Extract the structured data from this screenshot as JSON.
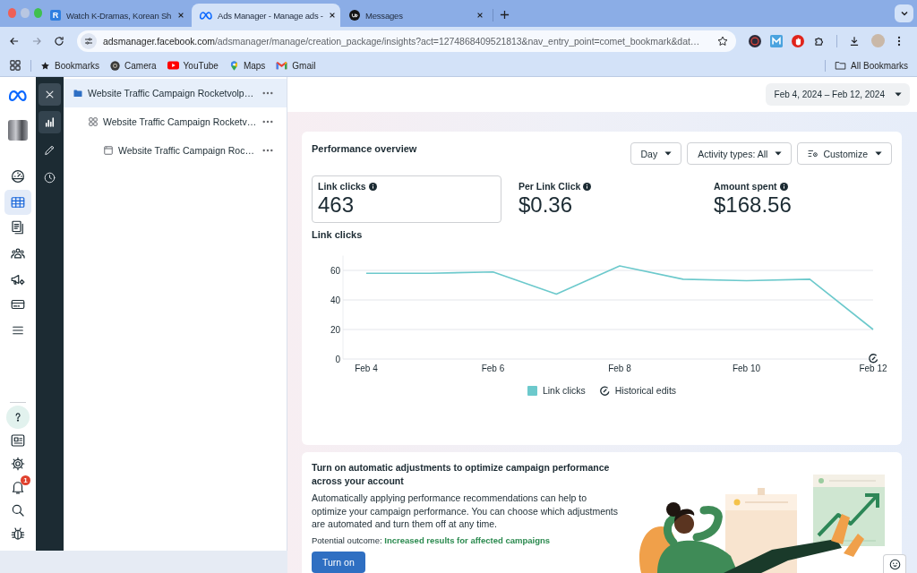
{
  "browser": {
    "tabs": [
      {
        "title": "Watch K-Dramas, Korean Sh",
        "kind": "letter",
        "favicon_text": "R",
        "selected": false
      },
      {
        "title": "Ads Manager - Manage ads -",
        "kind": "meta",
        "selected": true
      },
      {
        "title": "Messages",
        "kind": "round",
        "selected": false
      }
    ],
    "address": {
      "host": "adsmanager.facebook.com",
      "path": "/adsmanager/manage/creation_package/insights?act=1274868409521813&nav_entry_point=comet_bookmark&dat…"
    },
    "bookmarks": [
      {
        "label": "Bookmarks",
        "kind": "star"
      },
      {
        "label": "Camera",
        "kind": "camera"
      },
      {
        "label": "YouTube",
        "kind": "video"
      },
      {
        "label": "Maps",
        "kind": "pin"
      },
      {
        "label": "Gmail",
        "kind": "mail"
      }
    ],
    "all_bookmarks": "All Bookmarks"
  },
  "nav_rail": {
    "top": [
      {
        "kind": "gauge",
        "selected": false
      },
      {
        "kind": "table",
        "selected": true
      },
      {
        "kind": "pages",
        "selected": false
      },
      {
        "kind": "people",
        "selected": false
      },
      {
        "kind": "megaphone",
        "selected": false
      },
      {
        "kind": "card",
        "selected": false
      },
      {
        "kind": "menu",
        "selected": false
      }
    ],
    "bottom": [
      {
        "kind": "help"
      },
      {
        "kind": "news"
      },
      {
        "kind": "gear"
      },
      {
        "kind": "bell",
        "badge": "1"
      },
      {
        "kind": "search"
      },
      {
        "kind": "bug"
      }
    ]
  },
  "tool_rail": [
    {
      "kind": "chart",
      "selected": true
    },
    {
      "kind": "pencil",
      "selected": false
    },
    {
      "kind": "clock",
      "selected": false
    }
  ],
  "tree": [
    {
      "label": "Website Traffic Campaign Rocketvolp…",
      "kind": "campaign",
      "selected": true,
      "children": [
        {
          "label": "Website Traffic Campaign Rocketv…",
          "kind": "adset",
          "selected": false,
          "children": [
            {
              "label": "Website Traffic Campaign Roc…",
              "kind": "ad",
              "selected": false
            }
          ]
        }
      ]
    }
  ],
  "date_range": "Feb 4, 2024 – Feb 12, 2024",
  "performance": {
    "title": "Performance overview",
    "filters": [
      {
        "label": "Day",
        "kind": "dropdown"
      },
      {
        "label": "Activity types: All",
        "kind": "dropdown"
      },
      {
        "label": "Customize",
        "kind": "customize"
      }
    ],
    "metrics": [
      {
        "label": "Link clicks",
        "value": "463",
        "selected": true
      },
      {
        "label": "Per Link Click",
        "value": "$0.36",
        "selected": false
      },
      {
        "label": "Amount spent",
        "value": "$168.56",
        "selected": false
      }
    ],
    "chart_title": "Link clicks",
    "chart_data": {
      "type": "line",
      "categories": [
        "Feb 4",
        null,
        "Feb 6",
        null,
        "Feb 8",
        null,
        "Feb 10",
        null,
        "Feb 12"
      ],
      "ylim": [
        0,
        70
      ],
      "yticks": [
        0,
        20,
        40,
        60
      ],
      "grid": true,
      "series": [
        {
          "name": "Link clicks",
          "color": "#6cc9cc",
          "values": [
            58,
            58,
            59,
            44,
            63,
            54,
            53,
            54,
            20
          ]
        }
      ],
      "annotations": [
        {
          "x": "Feb 12"
        }
      ]
    },
    "edits_legend": "Historical edits"
  },
  "recommendation": {
    "title": "Turn on automatic adjustments to optimize campaign performance across your account",
    "body": "Automatically applying performance recommendations can help to optimize your campaign performance. You can choose which adjustments are automated and turn them off at any time.",
    "outcome": "Potential outcome: **Increased results for affected campaigns**",
    "button": "Turn on"
  }
}
